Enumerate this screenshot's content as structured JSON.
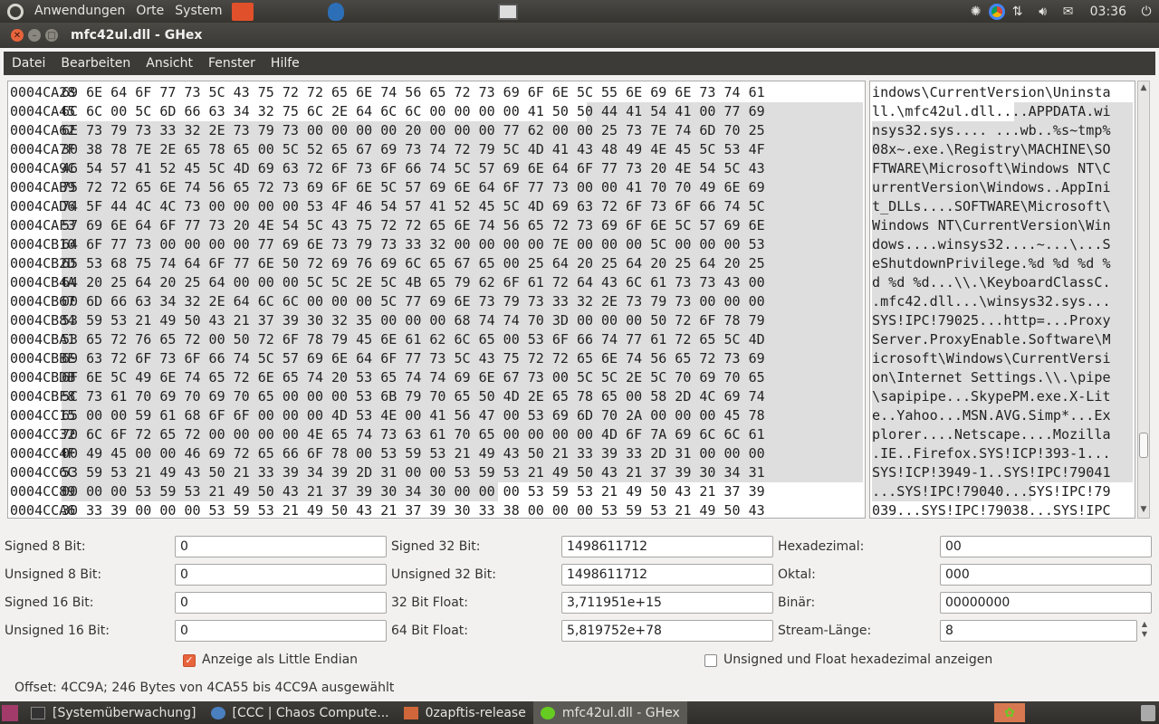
{
  "top_panel": {
    "menus": [
      "Anwendungen",
      "Orte",
      "System"
    ],
    "clock": "03:36",
    "tray_icons": [
      "network-icon",
      "chrome-icon",
      "updown-icon",
      "volume-icon",
      "mail-icon"
    ]
  },
  "window": {
    "title": "mfc42ul.dll - GHex"
  },
  "menubar": [
    "Datei",
    "Bearbeiten",
    "Ansicht",
    "Fenster",
    "Hilfe"
  ],
  "hex_rows": [
    {
      "offset": "0004CA28",
      "hex": "69 6E 64 6F 77 73 5C 43 75 72 72 65 6E 74 56 65 72 73 69 6F 6E 5C 55 6E 69 6E 73 74 61",
      "ascii": "indows\\CurrentVersion\\Uninsta"
    },
    {
      "offset": "0004CA45",
      "hex": "6C 6C 00 5C 6D 66 63 34 32 75 6C 2E 64 6C 6C 00 00 00 00 41 50 50 44 41 54 41 00 77 69",
      "ascii": "ll.\\mfc42ul.dll....APPDATA.wi"
    },
    {
      "offset": "0004CA62",
      "hex": "6E 73 79 73 33 32 2E 73 79 73 00 00 00 00 20 00 00 00 77 62 00 00 25 73 7E 74 6D 70 25",
      "ascii": "nsys32.sys.... ...wb..%s~tmp%"
    },
    {
      "offset": "0004CA7F",
      "hex": "30 38 78 7E 2E 65 78 65 00 5C 52 65 67 69 73 74 72 79 5C 4D 41 43 48 49 4E 45 5C 53 4F",
      "ascii": "08x~.exe.\\Registry\\MACHINE\\SO"
    },
    {
      "offset": "0004CA9C",
      "hex": "46 54 57 41 52 45 5C 4D 69 63 72 6F 73 6F 66 74 5C 57 69 6E 64 6F 77 73 20 4E 54 5C 43",
      "ascii": "FTWARE\\Microsoft\\Windows NT\\C"
    },
    {
      "offset": "0004CAB9",
      "hex": "75 72 72 65 6E 74 56 65 72 73 69 6F 6E 5C 57 69 6E 64 6F 77 73 00 00 41 70 70 49 6E 69",
      "ascii": "urrentVersion\\Windows..AppIni"
    },
    {
      "offset": "0004CAD6",
      "hex": "74 5F 44 4C 4C 73 00 00 00 00 53 4F 46 54 57 41 52 45 5C 4D 69 63 72 6F 73 6F 66 74 5C",
      "ascii": "t_DLLs....SOFTWARE\\Microsoft\\"
    },
    {
      "offset": "0004CAF3",
      "hex": "57 69 6E 64 6F 77 73 20 4E 54 5C 43 75 72 72 65 6E 74 56 65 72 73 69 6F 6E 5C 57 69 6E",
      "ascii": "Windows NT\\CurrentVersion\\Win"
    },
    {
      "offset": "0004CB10",
      "hex": "64 6F 77 73 00 00 00 00 77 69 6E 73 79 73 33 32 00 00 00 00 7E 00 00 00 5C 00 00 00 53",
      "ascii": "dows....winsys32....~...\\...S"
    },
    {
      "offset": "0004CB2D",
      "hex": "65 53 68 75 74 64 6F 77 6E 50 72 69 76 69 6C 65 67 65 00 25 64 20 25 64 20 25 64 20 25",
      "ascii": "eShutdownPrivilege.%d %d %d %"
    },
    {
      "offset": "0004CB4A",
      "hex": "64 20 25 64 20 25 64 00 00 00 5C 5C 2E 5C 4B 65 79 62 6F 61 72 64 43 6C 61 73 73 43 00",
      "ascii": "d %d %d...\\\\.\\KeyboardClassC."
    },
    {
      "offset": "0004CB67",
      "hex": "00 6D 66 63 34 32 2E 64 6C 6C 00 00 00 5C 77 69 6E 73 79 73 33 32 2E 73 79 73 00 00 00",
      "ascii": ".mfc42.dll...\\winsys32.sys..."
    },
    {
      "offset": "0004CB84",
      "hex": "53 59 53 21 49 50 43 21 37 39 30 32 35 00 00 00 68 74 74 70 3D 00 00 00 50 72 6F 78 79",
      "ascii": "SYS!IPC!79025...http=...Proxy"
    },
    {
      "offset": "0004CBA1",
      "hex": "53 65 72 76 65 72 00 50 72 6F 78 79 45 6E 61 62 6C 65 00 53 6F 66 74 77 61 72 65 5C 4D",
      "ascii": "Server.ProxyEnable.Software\\M"
    },
    {
      "offset": "0004CBBE",
      "hex": "69 63 72 6F 73 6F 66 74 5C 57 69 6E 64 6F 77 73 5C 43 75 72 72 65 6E 74 56 65 72 73 69",
      "ascii": "icrosoft\\Windows\\CurrentVersi"
    },
    {
      "offset": "0004CBDB",
      "hex": "6F 6E 5C 49 6E 74 65 72 6E 65 74 20 53 65 74 74 69 6E 67 73 00 5C 5C 2E 5C 70 69 70 65",
      "ascii": "on\\Internet Settings.\\\\.\\pipe"
    },
    {
      "offset": "0004CBF8",
      "hex": "5C 73 61 70 69 70 69 70 65 00 00 00 53 6B 79 70 65 50 4D 2E 65 78 65 00 58 2D 4C 69 74",
      "ascii": "\\sapipipe...SkypePM.exe.X-Lit"
    },
    {
      "offset": "0004CC15",
      "hex": "65 00 00 59 61 68 6F 6F 00 00 00 4D 53 4E 00 41 56 47 00 53 69 6D 70 2A 00 00 00 45 78",
      "ascii": "e..Yahoo...MSN.AVG.Simp*...Ex"
    },
    {
      "offset": "0004CC32",
      "hex": "70 6C 6F 72 65 72 00 00 00 00 4E 65 74 73 63 61 70 65 00 00 00 00 4D 6F 7A 69 6C 6C 61",
      "ascii": "plorer....Netscape....Mozilla"
    },
    {
      "offset": "0004CC4F",
      "hex": "00 49 45 00 00 46 69 72 65 66 6F 78 00 53 59 53 21 49 43 50 21 33 39 33 2D 31 00 00 00",
      "ascii": ".IE..Firefox.SYS!ICP!393-1..."
    },
    {
      "offset": "0004CC6C",
      "hex": "53 59 53 21 49 43 50 21 33 39 34 39 2D 31 00 00 53 59 53 21 49 50 43 21 37 39 30 34 31",
      "ascii": "SYS!ICP!3949-1..SYS!IPC!79041"
    },
    {
      "offset": "0004CC89",
      "hex": "00 00 00 53 59 53 21 49 50 43 21 37 39 30 34 30 00 00 00 53 59 53 21 49 50 43 21 37 39",
      "ascii": "...SYS!IPC!79040...SYS!IPC!79"
    },
    {
      "offset": "0004CCA6",
      "hex": "30 33 39 00 00 00 53 59 53 21 49 50 43 21 37 39 30 33 38 00 00 00 53 59 53 21 49 50 43",
      "ascii": "039...SYS!IPC!79038...SYS!IPC"
    }
  ],
  "converter": {
    "signed8_label": "Signed 8 Bit:",
    "signed8": "0",
    "unsigned8_label": "Unsigned 8 Bit:",
    "unsigned8": "0",
    "signed16_label": "Signed 16 Bit:",
    "signed16": "0",
    "unsigned16_label": "Unsigned 16 Bit:",
    "unsigned16": "0",
    "signed32_label": "Signed 32 Bit:",
    "signed32": "1498611712",
    "unsigned32_label": "Unsigned 32 Bit:",
    "unsigned32": "1498611712",
    "float32_label": "32 Bit Float:",
    "float32": "3,711951e+15",
    "float64_label": "64 Bit Float:",
    "float64": "5,819752e+78",
    "hex_label": "Hexadezimal:",
    "hex": "00",
    "octal_label": "Oktal:",
    "octal": "000",
    "binary_label": "Binär:",
    "binary": "00000000",
    "stream_label": "Stream-Länge:",
    "stream": "8",
    "little_endian_label": "Anzeige als Little Endian",
    "little_endian_checked": true,
    "unsigned_hex_label": "Unsigned und Float hexadezimal anzeigen",
    "unsigned_hex_checked": false
  },
  "status": "Offset: 4CC9A; 246 Bytes von 4CA55 bis 4CC9A ausgewählt",
  "taskbar": {
    "items": [
      "[Systemüberwachung]",
      "[CCC | Chaos Compute...",
      "0zapftis-release",
      "mfc42ul.dll - GHex"
    ]
  }
}
